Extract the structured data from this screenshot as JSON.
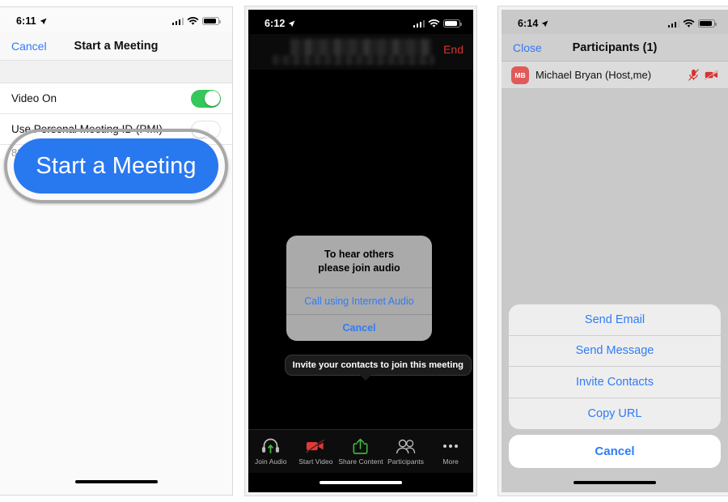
{
  "panels": [
    {
      "id": "start-meeting",
      "status_bar": {
        "time": "6:11",
        "location_icon": "location-arrow-icon",
        "signal_icon": "cellular-bars-icon",
        "wifi_icon": "wifi-icon",
        "battery_icon": "battery-icon"
      },
      "nav": {
        "left_label": "Cancel",
        "title": "Start a Meeting"
      },
      "rows": [
        {
          "label": "Video On",
          "toggle": "on"
        },
        {
          "label": "Use Personal Meeting ID (PMI)",
          "toggle": "off",
          "sub": "825"
        }
      ],
      "callout_button": {
        "label": "Start a Meeting",
        "color": "#2878f0",
        "ring_color": "#a8a8a8"
      }
    },
    {
      "id": "in-meeting",
      "status_bar": {
        "time": "6:12",
        "location_icon": "location-arrow-icon",
        "signal_icon": "cellular-bars-icon",
        "wifi_icon": "wifi-icon",
        "battery_icon": "battery-icon"
      },
      "meeting_header": {
        "end_label": "End",
        "end_color": "#d8332f",
        "title_redacted": true
      },
      "audio_alert": {
        "message_line1": "To hear others",
        "message_line2": "please join audio",
        "primary_label": "Call using Internet Audio",
        "cancel_label": "Cancel"
      },
      "tooltip": {
        "text": "Invite your contacts to join this meeting"
      },
      "toolbar": [
        {
          "label": "Join Audio",
          "icon": "headset-icon",
          "color": "#b9b9b9",
          "accent": "#3ec03e"
        },
        {
          "label": "Start Video",
          "icon": "video-off-icon",
          "color": "#e03a35"
        },
        {
          "label": "Share Content",
          "icon": "share-up-arrow-icon",
          "color": "#3ec03e"
        },
        {
          "label": "Participants",
          "icon": "participants-icon",
          "color": "#b9b9b9"
        },
        {
          "label": "More",
          "icon": "more-dots-icon",
          "color": "#cfcfcf"
        }
      ]
    },
    {
      "id": "participants",
      "status_bar": {
        "time": "6:14",
        "location_icon": "location-arrow-icon",
        "signal_icon": "cellular-bars-icon",
        "wifi_icon": "wifi-icon",
        "battery_icon": "battery-icon"
      },
      "nav": {
        "left_label": "Close",
        "title": "Participants (1)"
      },
      "participant": {
        "initials": "MB",
        "avatar_color": "#e05a5a",
        "name": "Michael Bryan (Host,me)",
        "mic_icon": "mic-muted-icon",
        "video_icon": "video-muted-icon",
        "icon_color": "#d8332f"
      },
      "action_sheet": {
        "options": [
          {
            "label": "Send Email"
          },
          {
            "label": "Send Message"
          },
          {
            "label": "Invite Contacts"
          },
          {
            "label": "Copy URL"
          }
        ],
        "cancel_label": "Cancel"
      }
    }
  ]
}
